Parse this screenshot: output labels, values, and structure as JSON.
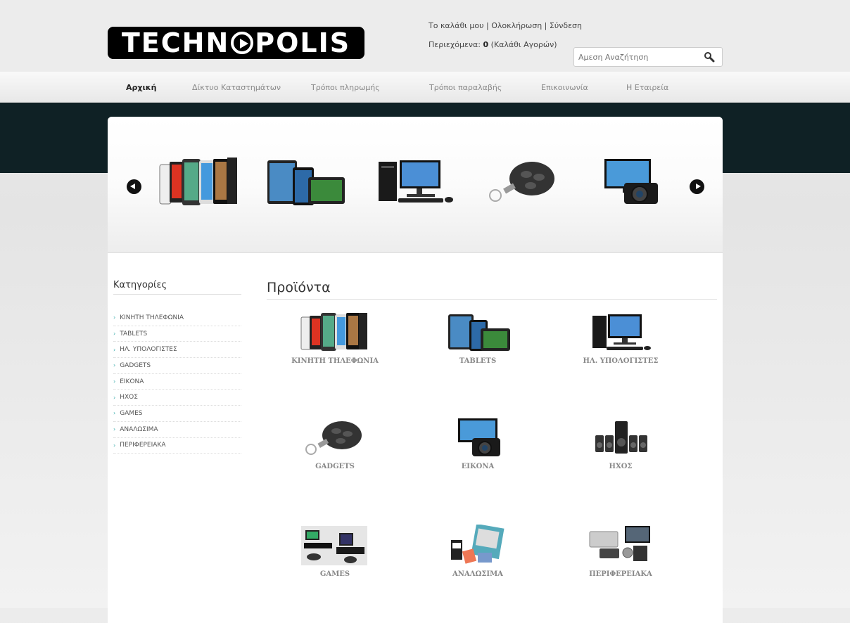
{
  "brand": {
    "logo_text_1": "TECHN",
    "logo_text_2": "POLIS"
  },
  "account": {
    "my_cart": "Το καλάθι μου",
    "sep1": " | ",
    "checkout": "Ολοκλήρωση",
    "sep2": " | ",
    "login": "Σύνδεση"
  },
  "cart": {
    "prefix": "Περιεχόμενα: ",
    "count": "0",
    "suffix": " (Καλάθι Αγορών)"
  },
  "search": {
    "placeholder": "Αμεση Αναζήτηση"
  },
  "nav": [
    "Αρχική",
    "Δίκτυο Καταστημάτων",
    "Τρόποι πληρωμής",
    "Τρόποι παραλαβής",
    "Επικοινωνία",
    "Η Εταιρεία"
  ],
  "sidebar": {
    "title": "Κατηγορίες",
    "items": [
      "ΚΙΝΗΤΗ ΤΗΛΕΦΩΝΙΑ",
      "TABLETS",
      "ΗΛ. ΥΠΟΛΟΓΙΣΤΕΣ",
      "GADGETS",
      "ΕΙΚΟΝΑ",
      "ΗΧΟΣ",
      "GAMES",
      "ΑΝΑΛΩΣΙΜΑ",
      "ΠΕΡΙΦΕΡΕΙΑΚΑ"
    ]
  },
  "main": {
    "title": "Προϊόντα",
    "products": [
      "ΚΙΝΗΤΗ ΤΗΛΕΦΩΝΙΑ",
      "TABLETS",
      "ΗΛ. ΥΠΟΛΟΓΙΣΤΕΣ",
      "GADGETS",
      "ΕΙΚΟΝΑ",
      "ΗΧΟΣ",
      "GAMES",
      "ΑΝΑΛΩΣΙΜΑ",
      "ΠΕΡΙΦΕΡΕΙΑΚΑ"
    ]
  },
  "colors": {
    "dark_band": "#0f2125",
    "accent": "#3aa"
  }
}
